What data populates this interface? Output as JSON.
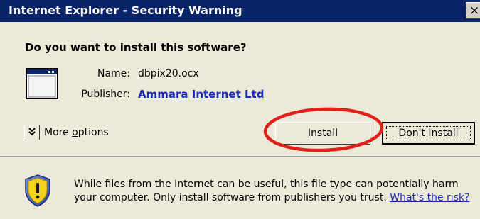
{
  "window": {
    "title": "Internet Explorer - Security Warning",
    "close_glyph": "×"
  },
  "prompt": {
    "question": "Do you want to install this software?"
  },
  "details": {
    "name_label": "Name:",
    "name_value": "dbpix20.ocx",
    "publisher_label": "Publisher:",
    "publisher_value": "Ammara Internet Ltd"
  },
  "more_options": {
    "glyph": "¥",
    "label_prefix": "More ",
    "label_mnemonic": "o",
    "label_rest": "ptions"
  },
  "buttons": {
    "install_mnemonic": "I",
    "install_rest": "nstall",
    "dont_install_mnemonic": "D",
    "dont_install_rest": "on't Install"
  },
  "warning": {
    "line1": "While files from the Internet can be useful, this file type can potentially harm",
    "line2": "your computer. Only install software from publishers you trust.",
    "risk_link": "What's the risk?"
  },
  "icons": {
    "application": "window-app-icon",
    "shield": "shield-warning-icon",
    "more_options": "chevron-double-down-icon"
  },
  "colors": {
    "titlebar": "#0a246a",
    "dialog_bg": "#ece9d8",
    "link": "#1b2bb8",
    "annotation": "#e0201a"
  }
}
